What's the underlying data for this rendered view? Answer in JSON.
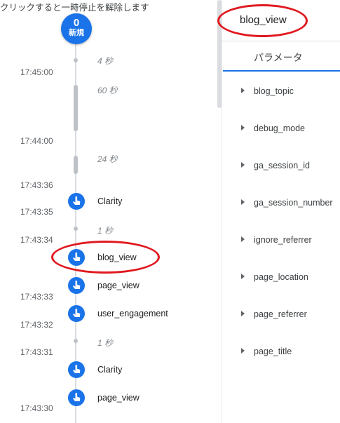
{
  "hint": "クリックすると一時停止を解除します",
  "new_badge": {
    "count": "0",
    "label": "新規"
  },
  "timeline": {
    "times": [
      "17:45:00",
      "17:44:00",
      "17:43:36",
      "17:43:35",
      "17:43:34",
      "17:43:33",
      "17:43:32",
      "17:43:31",
      "17:43:30"
    ],
    "gaps": [
      "4 秒",
      "60 秒",
      "24 秒",
      "1 秒",
      "1 秒"
    ],
    "events": [
      "Clarity",
      "blog_view",
      "page_view",
      "user_engagement",
      "Clarity",
      "page_view"
    ]
  },
  "panel": {
    "title": "blog_view",
    "tab": "パラメータ",
    "params": [
      "blog_topic",
      "debug_mode",
      "ga_session_id",
      "ga_session_number",
      "ignore_referrer",
      "page_location",
      "page_referrer",
      "page_title"
    ]
  },
  "colors": {
    "accent": "#1a73e8",
    "highlight": "#e0191f"
  }
}
